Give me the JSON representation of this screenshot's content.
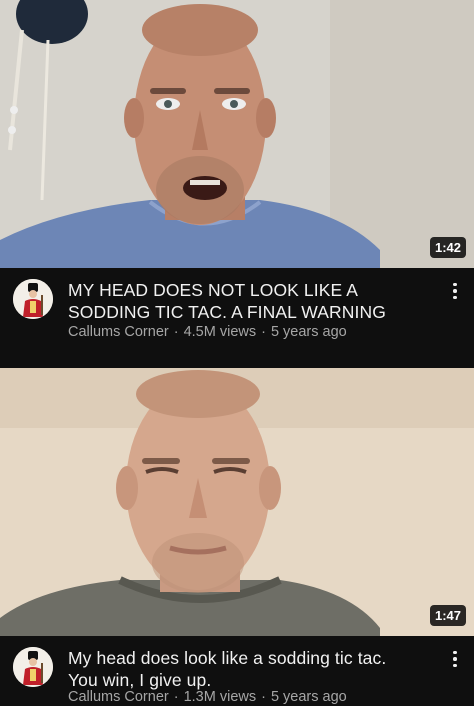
{
  "videos": [
    {
      "duration": "1:42",
      "title_line1": "MY HEAD DOES NOT LOOK LIKE A",
      "title_line2": "SODDING TIC TAC. A FINAL WARNING",
      "channel": "Callums Corner",
      "views": "4.5M views",
      "age": "5 years ago"
    },
    {
      "duration": "1:47",
      "title_line1": "My head does look like a sodding tic tac.",
      "title_line2": "You win, I give up.",
      "channel": "Callums Corner",
      "views": "1.3M views",
      "age": "5 years ago"
    }
  ],
  "separator": "·",
  "icons": {
    "more": "more-vert-icon",
    "avatar": "channel-avatar-icon"
  },
  "colors": {
    "background": "#0f0f0f",
    "title": "#f1f1f1",
    "meta": "#a6a6a6",
    "duration_bg": "#000000"
  }
}
